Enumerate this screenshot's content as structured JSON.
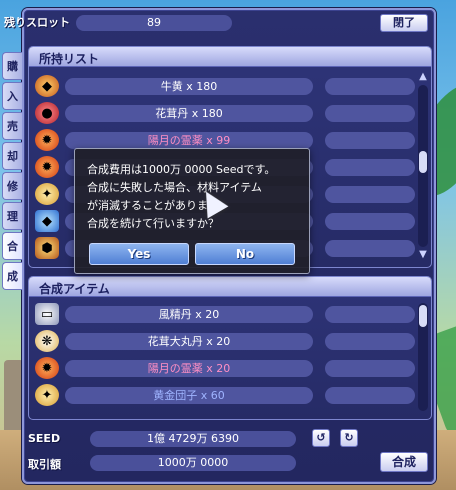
{
  "header": {
    "slot_label": "残りスロット",
    "slot_value": "89",
    "close_label": "閉了"
  },
  "side_tabs": [
    "購",
    "入",
    "売",
    "却",
    "修",
    "理",
    "合",
    "成"
  ],
  "owned_list": {
    "title": "所持リスト",
    "items": [
      {
        "label": "牛黄 x 180",
        "color": "white",
        "icon": "orange-gem-icon"
      },
      {
        "label": "花茸丹 x 180",
        "color": "white",
        "icon": "red-pill-icon"
      },
      {
        "label": "陽月の霊薬 x 99",
        "color": "pink",
        "icon": "fire-orb-icon"
      },
      {
        "label": "",
        "color": "white",
        "icon": "fire-orb-icon"
      },
      {
        "label": "",
        "color": "white",
        "icon": "golden-orb-icon"
      },
      {
        "label": "",
        "color": "white",
        "icon": "blue-crystal-icon"
      },
      {
        "label": "",
        "color": "white",
        "icon": "golden-shield-icon"
      }
    ]
  },
  "synthesis_list": {
    "title": "合成アイテム",
    "items": [
      {
        "label": "風精丹 x 20",
        "color": "white",
        "icon": "silver-scroll-icon"
      },
      {
        "label": "花茸大丸丹 x 20",
        "color": "white",
        "icon": "jewel-cluster-icon"
      },
      {
        "label": "陽月の霊薬 x 20",
        "color": "pink",
        "icon": "fire-orb-icon"
      },
      {
        "label": "黄金団子 x 60",
        "color": "blue",
        "icon": "golden-orb-icon"
      }
    ]
  },
  "footer": {
    "seed_label": "SEED",
    "seed_value": "1億 4729万 6390",
    "trade_label": "取引額",
    "trade_value": "1000万 0000",
    "synth_button": "合成"
  },
  "dialog": {
    "lines": [
      "合成費用は1000万 0000 Seedです。",
      "合成に失敗した場合、材料アイテム",
      "が消滅することがあります。",
      "合成を続けて行いますか？"
    ],
    "yes_label": "Yes",
    "no_label": "No"
  }
}
